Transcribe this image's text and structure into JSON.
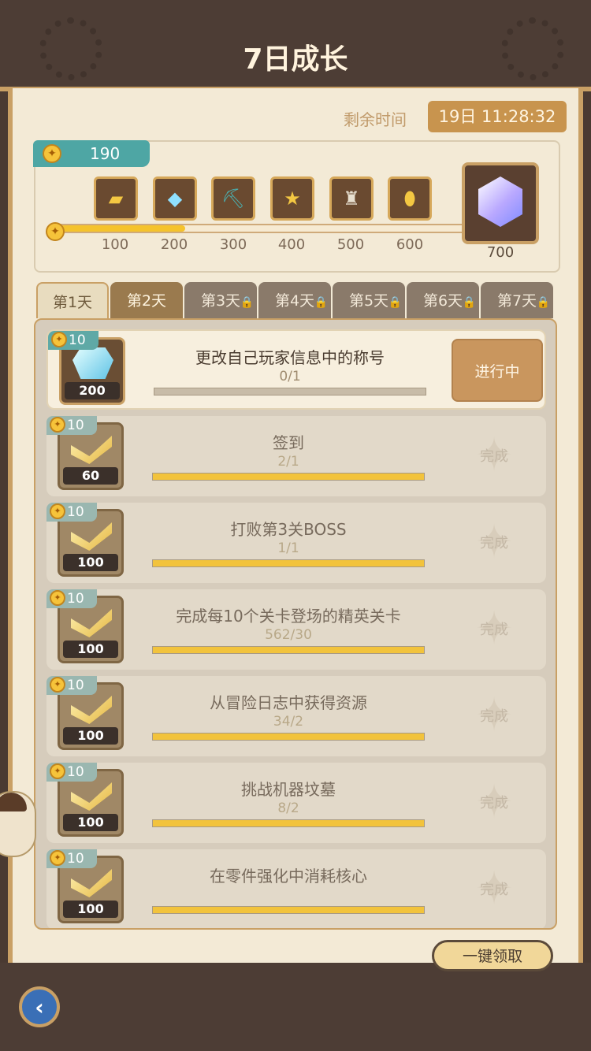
{
  "header": {
    "title": "7日成长"
  },
  "timer": {
    "label": "剩余时间",
    "value": "19日 11:28:32"
  },
  "progress": {
    "points": "190",
    "current": 190,
    "max": 700,
    "milestones": [
      "100",
      "200",
      "300",
      "400",
      "500",
      "600"
    ],
    "final": "700",
    "chest_icons": [
      "gold-bars-icon",
      "diamond-icon",
      "pickaxe-icon",
      "three-stars-card-icon",
      "rank-card-icon",
      "egg-card-icon"
    ],
    "final_icon": "crystal-icon"
  },
  "tabs": [
    {
      "label": "第1天",
      "state": "active"
    },
    {
      "label": "第2天",
      "state": "open"
    },
    {
      "label": "第3天",
      "state": "locked"
    },
    {
      "label": "第4天",
      "state": "locked"
    },
    {
      "label": "第5天",
      "state": "locked"
    },
    {
      "label": "第6天",
      "state": "locked"
    },
    {
      "label": "第7天",
      "state": "locked"
    }
  ],
  "tasks": [
    {
      "points": "10",
      "reward": "200",
      "reward_icon": "diamond-icon",
      "name": "更改自己玩家信息中的称号",
      "progress": "0/1",
      "fill": 0,
      "action": "进行中"
    },
    {
      "points": "10",
      "reward": "60",
      "reward_icon": "gold-bars-icon",
      "name": "签到",
      "progress": "2/1",
      "fill": 1,
      "action": "完成"
    },
    {
      "points": "10",
      "reward": "100",
      "reward_icon": "gold-bars-icon",
      "name": "打败第3关BOSS",
      "progress": "1/1",
      "fill": 1,
      "action": "完成"
    },
    {
      "points": "10",
      "reward": "100",
      "reward_icon": "gold-bars-icon",
      "name": "完成每10个关卡登场的精英关卡",
      "progress": "562/30",
      "fill": 1,
      "action": "完成"
    },
    {
      "points": "10",
      "reward": "100",
      "reward_icon": "gold-bars-icon",
      "name": "从冒险日志中获得资源",
      "progress": "34/2",
      "fill": 1,
      "action": "完成"
    },
    {
      "points": "10",
      "reward": "100",
      "reward_icon": "gold-bars-icon",
      "name": "挑战机器坟墓",
      "progress": "8/2",
      "fill": 1,
      "action": "完成"
    },
    {
      "points": "10",
      "reward": "100",
      "reward_icon": "gold-bars-icon",
      "name": "在零件强化中消耗核心",
      "progress": "",
      "fill": 1,
      "action": "完成"
    }
  ],
  "footer": {
    "claim_all": "一键领取",
    "back_icon": "back-arrow-icon"
  },
  "colors": {
    "accent": "#c9a065",
    "teal": "#4ea6a4",
    "bar_fill": "#f5c32c"
  }
}
